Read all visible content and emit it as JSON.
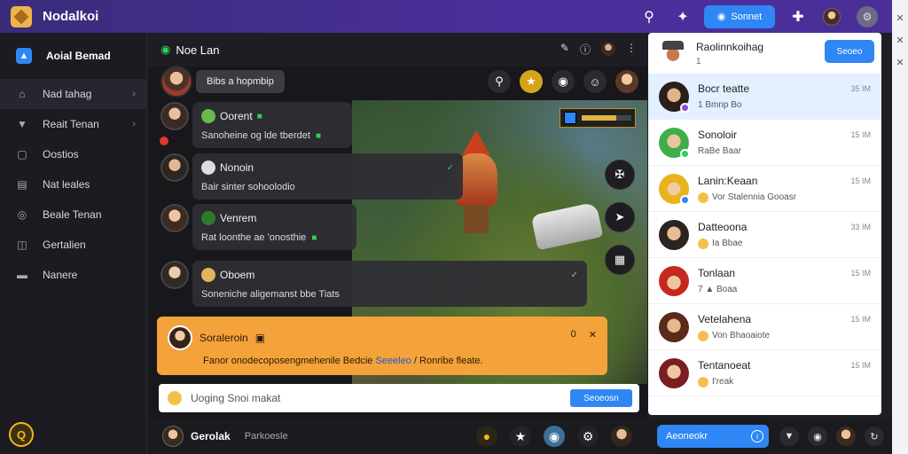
{
  "app": {
    "title": "Nodalkoi"
  },
  "topbar": {
    "primary_button": "Sonnet",
    "gear": "⚙"
  },
  "sidebar": {
    "brand": "Aoial Bemad",
    "items": [
      {
        "label": "Nad tahag",
        "icon": "home-icon",
        "chev": "›"
      },
      {
        "label": "Reait Tenan",
        "icon": "shield-icon",
        "chev": "›"
      },
      {
        "label": "Oostios",
        "icon": "box-icon"
      },
      {
        "label": "Nat leales",
        "icon": "list-icon"
      },
      {
        "label": "Beale Tenan",
        "icon": "circle-icon"
      },
      {
        "label": "Gertalien",
        "icon": "chat-icon"
      },
      {
        "label": "Nanere",
        "icon": "folder-icon"
      }
    ],
    "bottom_badge": "Q"
  },
  "main": {
    "title": "Noe Lan",
    "search_pill": "Bibs a hopmbip",
    "messages": [
      {
        "name": "Oorent",
        "text": "Sanoheine og lde tberdet"
      },
      {
        "name": "Nonoin",
        "text": "Bair sinter sohoolodio"
      },
      {
        "name": "Venrem",
        "text": "Rat loonthe ae 'onosthie"
      },
      {
        "name": "Oboem",
        "text": "Soneniche aligemanst bbe Tiats"
      }
    ],
    "highlight": {
      "name": "Soraleroin",
      "count": "0",
      "text_before": "Fanor onodecoposengmehenile Bedcie",
      "link": "Seeeleo",
      "text_after": "/ Ronribe fleate."
    },
    "input_placeholder": "Uoging Snoi makat",
    "send_label": "Seoeosn"
  },
  "footer": {
    "name": "Gerolak",
    "sub": "Parkoesle",
    "button_label": "Aeoneokr"
  },
  "rpanel": {
    "header_title": "Raolinnkoihag",
    "header_sub": "1",
    "header_button": "Seoeo",
    "contacts": [
      {
        "name": "Bocr teatte",
        "sub": "1 Bmnp Bo",
        "time": "35 IM",
        "selected": true
      },
      {
        "name": "Sonoloir",
        "sub": "RaBe Baar",
        "time": "15 IM"
      },
      {
        "name": "Lanin:Keaan",
        "sub": "Vor Stalennia Gooasr",
        "time": "15 IM"
      },
      {
        "name": "Datteoona",
        "sub": "Ia Bbae",
        "time": "33 IM"
      },
      {
        "name": "Tonlaan",
        "sub": "7 ▲ Boaa",
        "time": "15 IM"
      },
      {
        "name": "Vetelahena",
        "sub": "Von Bhaoaiote",
        "time": "15 IM"
      },
      {
        "name": "Tentanoeat",
        "sub": "I'reak",
        "time": "15 IM"
      }
    ]
  },
  "colors": {
    "accent": "#2f86f5",
    "topbar": "#4b2f9c",
    "highlight": "#f4a23a",
    "online": "#2fd05a"
  }
}
